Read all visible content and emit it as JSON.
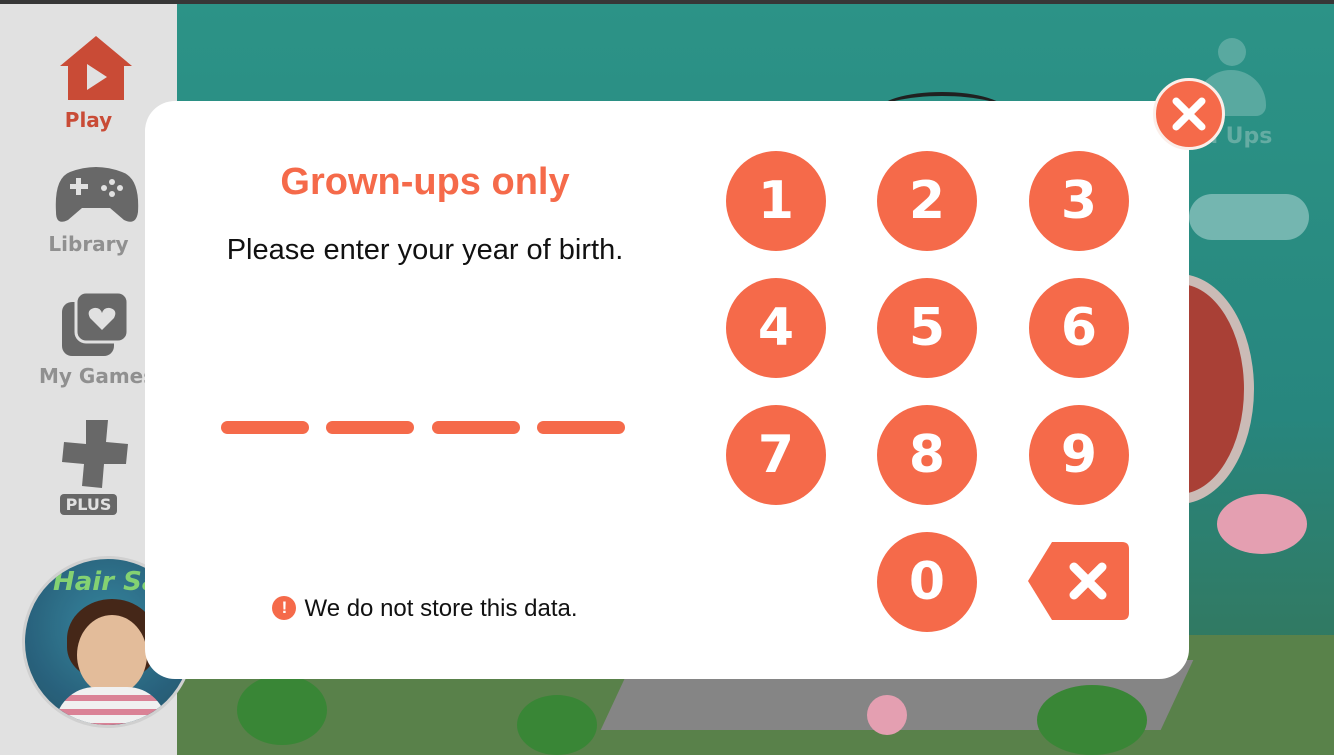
{
  "sidebar": {
    "items": [
      {
        "label": "Play",
        "icon": "home-play-icon"
      },
      {
        "label": "Library",
        "icon": "gamepad-icon"
      },
      {
        "label": "My Games",
        "icon": "heart-cards-icon"
      },
      {
        "label": "PLUS",
        "icon": "plus-icon"
      }
    ],
    "featured_game": "Hair Salo"
  },
  "background": {
    "grown_ups_label": "wn Ups"
  },
  "modal": {
    "title": "Grown-ups only",
    "prompt": "Please enter your year of birth.",
    "entered_digits": [
      "",
      "",
      "",
      ""
    ],
    "note": "We do not store this data.",
    "note_icon": "!",
    "keypad": [
      "1",
      "2",
      "3",
      "4",
      "5",
      "6",
      "7",
      "8",
      "9",
      "0"
    ],
    "backspace_icon": "backspace-icon",
    "close_icon": "close-icon"
  },
  "colors": {
    "accent": "#f56a4a",
    "sidebar_bg": "#f0f0f0",
    "sidebar_text": "#9a9a9a",
    "play_active": "#d6503a"
  }
}
